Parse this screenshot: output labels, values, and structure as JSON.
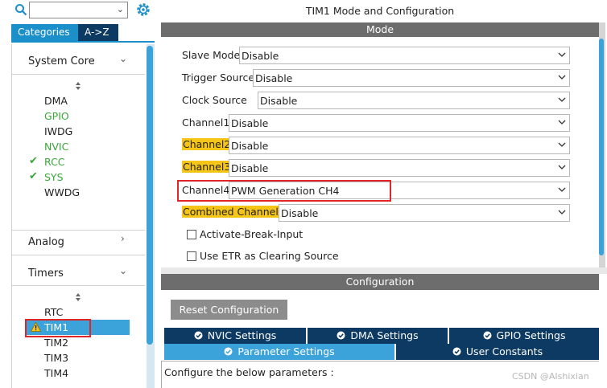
{
  "left": {
    "search": {
      "value": "",
      "placeholder": ""
    },
    "tabs": [
      "Categories",
      "A->Z"
    ],
    "categories": [
      {
        "name": "System Core",
        "items": [
          "DMA",
          "GPIO",
          "IWDG",
          "NVIC",
          "RCC",
          "SYS",
          "WWDG"
        ]
      },
      {
        "name": "Analog"
      },
      {
        "name": "Timers",
        "items": [
          "RTC",
          "TIM1",
          "TIM2",
          "TIM3",
          "TIM4"
        ]
      }
    ]
  },
  "right": {
    "title": "TIM1 Mode and Configuration",
    "mode_header": "Mode",
    "fields": [
      {
        "label": "Slave Mode",
        "value": "Disable"
      },
      {
        "label": "Trigger Source",
        "value": "Disable"
      },
      {
        "label": "Clock Source",
        "value": "Disable"
      },
      {
        "label": "Channel1",
        "value": "Disable"
      },
      {
        "label": "Channel2",
        "value": "Disable"
      },
      {
        "label": "Channel3",
        "value": "Disable"
      },
      {
        "label": "Channel4",
        "value": "PWM Generation CH4"
      },
      {
        "label": "Combined Channels",
        "value": "Disable"
      }
    ],
    "checkboxes": [
      "Activate-Break-Input",
      "Use ETR as Clearing Source"
    ],
    "config_header": "Configuration",
    "reset_button": "Reset Configuration",
    "config_tabs_row1": [
      "NVIC Settings",
      "DMA Settings",
      "GPIO Settings"
    ],
    "config_tabs_row2": [
      "Parameter Settings",
      "User Constants"
    ],
    "config_hint": "Configure the below parameters :"
  },
  "watermark": "CSDN @AIshixian",
  "colors": {
    "accent": "#3ca3da",
    "dark_tab": "#0d3a63",
    "highlight": "#f5c518",
    "check": "#3aa63a",
    "outline": "#e02626",
    "header": "#6d6d6d"
  },
  "icons": {
    "search": "search-icon",
    "settings": "gear-icon",
    "warning": "warning-icon",
    "check": "check-icon",
    "tab_status": "check-circle-icon"
  }
}
